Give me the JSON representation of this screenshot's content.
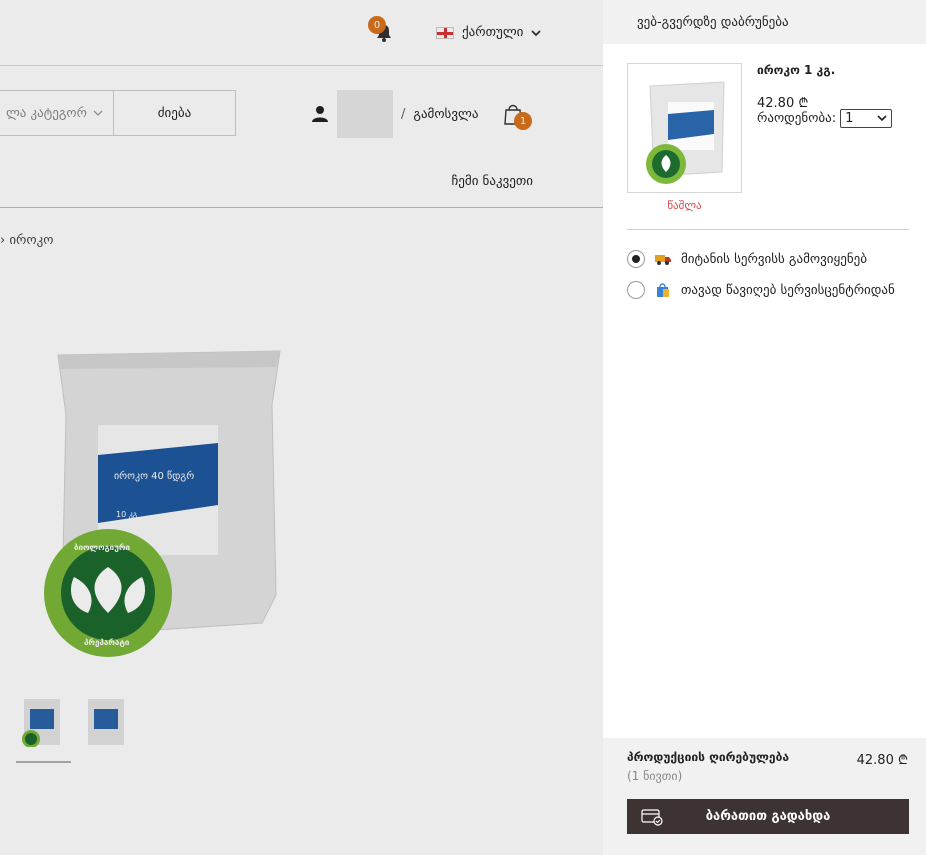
{
  "header": {
    "notification_count": "0",
    "language_label": "ქართული"
  },
  "search": {
    "category_placeholder": "ლა კატეგორ",
    "search_button": "ძიება"
  },
  "user": {
    "separator": "/",
    "logout_label": "გამოსვლა",
    "cart_count": "1"
  },
  "nav": {
    "my_purchases": "ჩემი ნაკვეთი"
  },
  "breadcrumb": {
    "text": "› იროკო"
  },
  "product_image": {
    "label": "იროკო 40 წდგრ",
    "weight": "10 კგ",
    "bio_top": "ბიოლოგიური",
    "bio_bottom": "პრეპარატი"
  },
  "drawer": {
    "back_label": "ვებ-გვერდზე დაბრუნება",
    "item": {
      "name": "იროკო 1 კგ.",
      "price": "42.80 ₾",
      "quantity_label": "რაოდენობა:",
      "quantity_value": "1",
      "remove_label": "წაშლა"
    },
    "delivery_options": [
      {
        "label": "მიტანის სერვისს გამოვიყენებ",
        "selected": true,
        "icon": "truck-icon"
      },
      {
        "label": "თავად წავიღებ სერვისცენტრიდან",
        "selected": false,
        "icon": "shopping-bag-icon"
      }
    ],
    "summary": {
      "label": "პროდუქციის ღირებულება",
      "count": "(1 ნივთი)",
      "total": "42.80 ₾"
    },
    "pay_button": "ბარათით გადახდა"
  },
  "colors": {
    "accent": "#d9731d",
    "pay_button": "#3d3333",
    "remove": "#d24a4a",
    "bio_green": "#7cb83a"
  }
}
